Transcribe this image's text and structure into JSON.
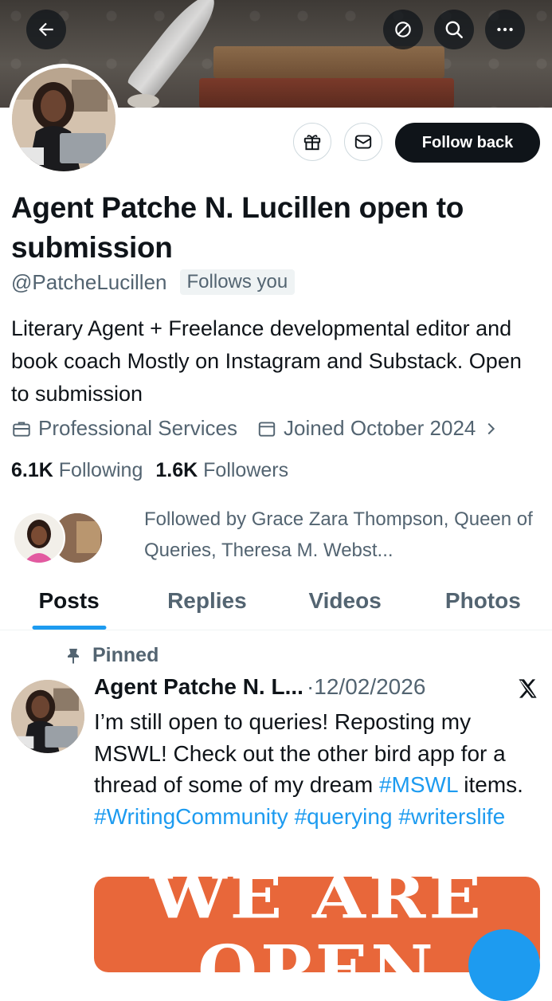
{
  "header": {
    "back_icon": "arrow-left-icon",
    "refresh_icon": "circle-slash-icon",
    "search_icon": "search-icon",
    "more_icon": "more-horizontal-icon"
  },
  "profile": {
    "name": "Agent Patche N. Lucillen open to submission",
    "handle": "@PatcheLucillen",
    "follows_you": "Follows you",
    "bio": "Literary Agent + Freelance developmental editor and book coach Mostly on Instagram and Substack. Open to submission",
    "category": "Professional Services",
    "joined": "Joined October 2024",
    "following_count": "6.1K",
    "following_label": "Following",
    "followers_count": "1.6K",
    "followers_label": "Followers",
    "followed_by": "Followed by Grace Zara Thompson, Queen of Queries, Theresa M. Webst..."
  },
  "actions": {
    "gift_icon": "gift-icon",
    "message_icon": "mail-icon",
    "follow_back": "Follow back"
  },
  "tabs": [
    {
      "label": "Posts",
      "active": true
    },
    {
      "label": "Replies",
      "active": false
    },
    {
      "label": "Videos",
      "active": false
    },
    {
      "label": "Photos",
      "active": false
    }
  ],
  "post": {
    "pinned_label": "Pinned",
    "author": "Agent Patche N. L...",
    "separator": "·",
    "date": "12/02/2026",
    "text_plain_1": "I’m still open to queries! Reposting my MSWL! Check out the other bird app for a thread of some of my dream ",
    "tag1": "#MSWL",
    "text_plain_2": " items. ",
    "tag2": "#WritingCommunity",
    "tag3": "#querying",
    "tag4": "#writerslife",
    "image_text_line1": "WE ARE",
    "image_text_line2": "OPEN"
  },
  "colors": {
    "accent": "#1d9bf0",
    "text_primary": "#0f1419",
    "text_secondary": "#536471",
    "image_bg": "#e8673a"
  }
}
